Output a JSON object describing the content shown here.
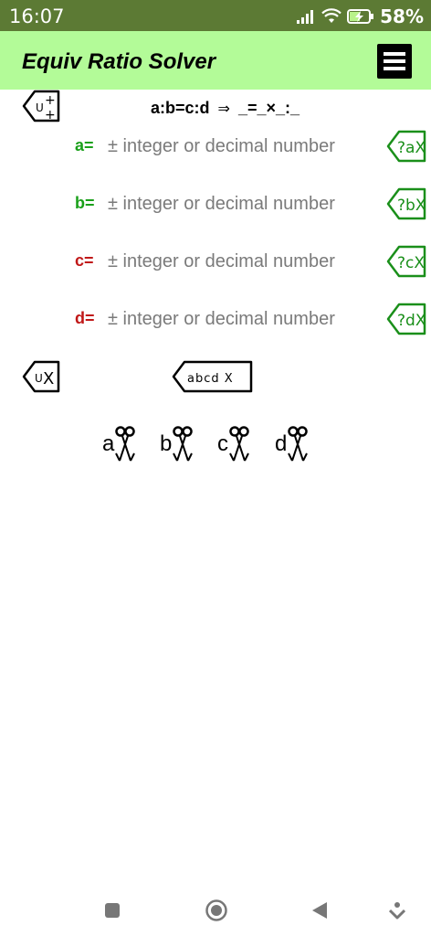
{
  "status_bar": {
    "time": "16:07",
    "battery_percent": "58%"
  },
  "app_bar": {
    "title": "Equiv Ratio Solver",
    "menu_icon": "hamburger-menu-icon"
  },
  "top_controls": {
    "formula_left": "a:b=c:d",
    "formula_arrow": "⇒",
    "formula_right": "_=_×_:_"
  },
  "rows": [
    {
      "label": "a=",
      "placeholder": "± integer or decimal number",
      "value": "",
      "clear_tag": "?aX",
      "color": "#1aa01a"
    },
    {
      "label": "b=",
      "placeholder": "± integer or decimal number",
      "value": "",
      "clear_tag": "?bX",
      "color": "#1aa01a"
    },
    {
      "label": "c=",
      "placeholder": "± integer or decimal number",
      "value": "",
      "clear_tag": "?cX",
      "color": "#c01818"
    },
    {
      "label": "d=",
      "placeholder": "± integer or decimal number",
      "value": "",
      "clear_tag": "?dX",
      "color": "#c01818"
    }
  ],
  "clear_all_tag": "abcd X",
  "cut_buttons": [
    "a",
    "b",
    "c",
    "d"
  ],
  "colors": {
    "accent_green": "#1aa01a",
    "accent_red": "#c01818",
    "appbar_bg": "#b3fb98",
    "statusbar_bg": "#5c7a34"
  }
}
